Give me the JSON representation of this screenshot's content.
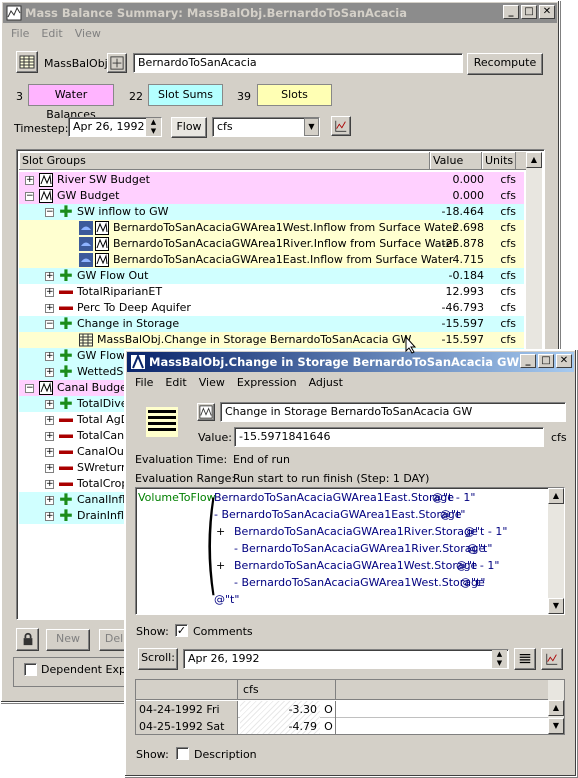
{
  "main_window": {
    "title": "Mass Balance Summary: MassBalObj.BernardoToSanAcacia",
    "menu": [
      "File",
      "Edit",
      "View"
    ],
    "object_type": "MassBalObj",
    "object_name": "BernardoToSanAcacia",
    "recompute_label": "Recompute",
    "counts": {
      "water_balances_count": "3",
      "water_balances_label": "Water Balances",
      "slot_sums_count": "22",
      "slot_sums_label": "Slot Sums",
      "slots_count": "39",
      "slots_label": "Slots"
    },
    "timestep_label": "Timestep:",
    "timestep_value": "Apr 26, 1992",
    "flow_label": "Flow",
    "units_value": "cfs",
    "columns": [
      "Slot Groups",
      "Value",
      "Units"
    ],
    "rows": [
      {
        "name": "River SW Budget",
        "value": "0.000",
        "unit": "cfs"
      },
      {
        "name": "GW Budget",
        "value": "0.000",
        "unit": "cfs"
      },
      {
        "name": "SW inflow to GW",
        "value": "-18.464",
        "unit": "cfs"
      },
      {
        "name": "BernardoToSanAcaciaGWArea1West.Inflow from Surface Water",
        "value": "2.698",
        "unit": "cfs"
      },
      {
        "name": "BernardoToSanAcaciaGWArea1River.Inflow from Surface Water",
        "value": "-25.878",
        "unit": "cfs"
      },
      {
        "name": "BernardoToSanAcaciaGWArea1East.Inflow from Surface Water",
        "value": "4.715",
        "unit": "cfs"
      },
      {
        "name": "GW Flow Out",
        "value": "-0.184",
        "unit": "cfs"
      },
      {
        "name": "TotalRiparianET",
        "value": "12.993",
        "unit": "cfs"
      },
      {
        "name": "Perc To Deep Aquifer",
        "value": "-46.793",
        "unit": "cfs"
      },
      {
        "name": "Change in Storage",
        "value": "-15.597",
        "unit": "cfs"
      },
      {
        "name": "MassBalObj.Change in Storage BernardoToSanAcacia GW",
        "value": "-15.597",
        "unit": "cfs"
      },
      {
        "name": "GW Flow",
        "value": "",
        "unit": ""
      },
      {
        "name": "WettedS",
        "value": "",
        "unit": ""
      },
      {
        "name": "Canal Budget",
        "value": "",
        "unit": ""
      },
      {
        "name": "TotalDive",
        "value": "",
        "unit": ""
      },
      {
        "name": "Total AgD",
        "value": "",
        "unit": ""
      },
      {
        "name": "TotalCan",
        "value": "",
        "unit": ""
      },
      {
        "name": "CanalOut",
        "value": "",
        "unit": ""
      },
      {
        "name": "SWreturn",
        "value": "",
        "unit": ""
      },
      {
        "name": "TotalCrop",
        "value": "",
        "unit": ""
      },
      {
        "name": "CanalInfl",
        "value": "",
        "unit": ""
      },
      {
        "name": "DrainInfl",
        "value": "",
        "unit": ""
      }
    ],
    "new_label": "New",
    "delete_label": "Del",
    "dependent_expr_label": "Dependent Expre"
  },
  "slot_window": {
    "title": "MassBalObj.Change in Storage BernardoToSanAcacia GW",
    "menu": [
      "File",
      "Edit",
      "View",
      "Expression",
      "Adjust"
    ],
    "slot_name": "Change in Storage BernardoToSanAcacia GW",
    "value_label": "Value:",
    "value": "-15.5971841646",
    "value_unit": "cfs",
    "eval_time_label": "Evaluation Time:",
    "eval_time_value": "End of run",
    "eval_range_label": "Evaluation Range:",
    "eval_range_value": "Run start to run finish (Step: 1 DAY)",
    "function_name": "VolumeToFlow",
    "expr_lines": [
      "BernardoToSanAcaciaGWArea1East.Storage",
      "- BernardoToSanAcaciaGWArea1East.Storage",
      "BernardoToSanAcaciaGWArea1River.Storage",
      "- BernardoToSanAcaciaGWArea1River.Storage",
      "BernardoToSanAcaciaGWArea1West.Storage",
      "- BernardoToSanAcaciaGWArea1West.Storage"
    ],
    "at_prev": "@\"t - 1\"",
    "at_t": "@\"t\"",
    "show_label": "Show:",
    "comments_label": "Comments",
    "comments_checked": true,
    "scroll_label": "Scroll:",
    "scroll_value": "Apr 26, 1992",
    "table_header": "cfs",
    "table_rows": [
      {
        "date": "04-24-1992 Fri",
        "value": "-3.30",
        "flag": "O"
      },
      {
        "date": "04-25-1992 Sat",
        "value": "-4.79",
        "flag": "O"
      }
    ],
    "description_label": "Description",
    "description_checked": false
  }
}
